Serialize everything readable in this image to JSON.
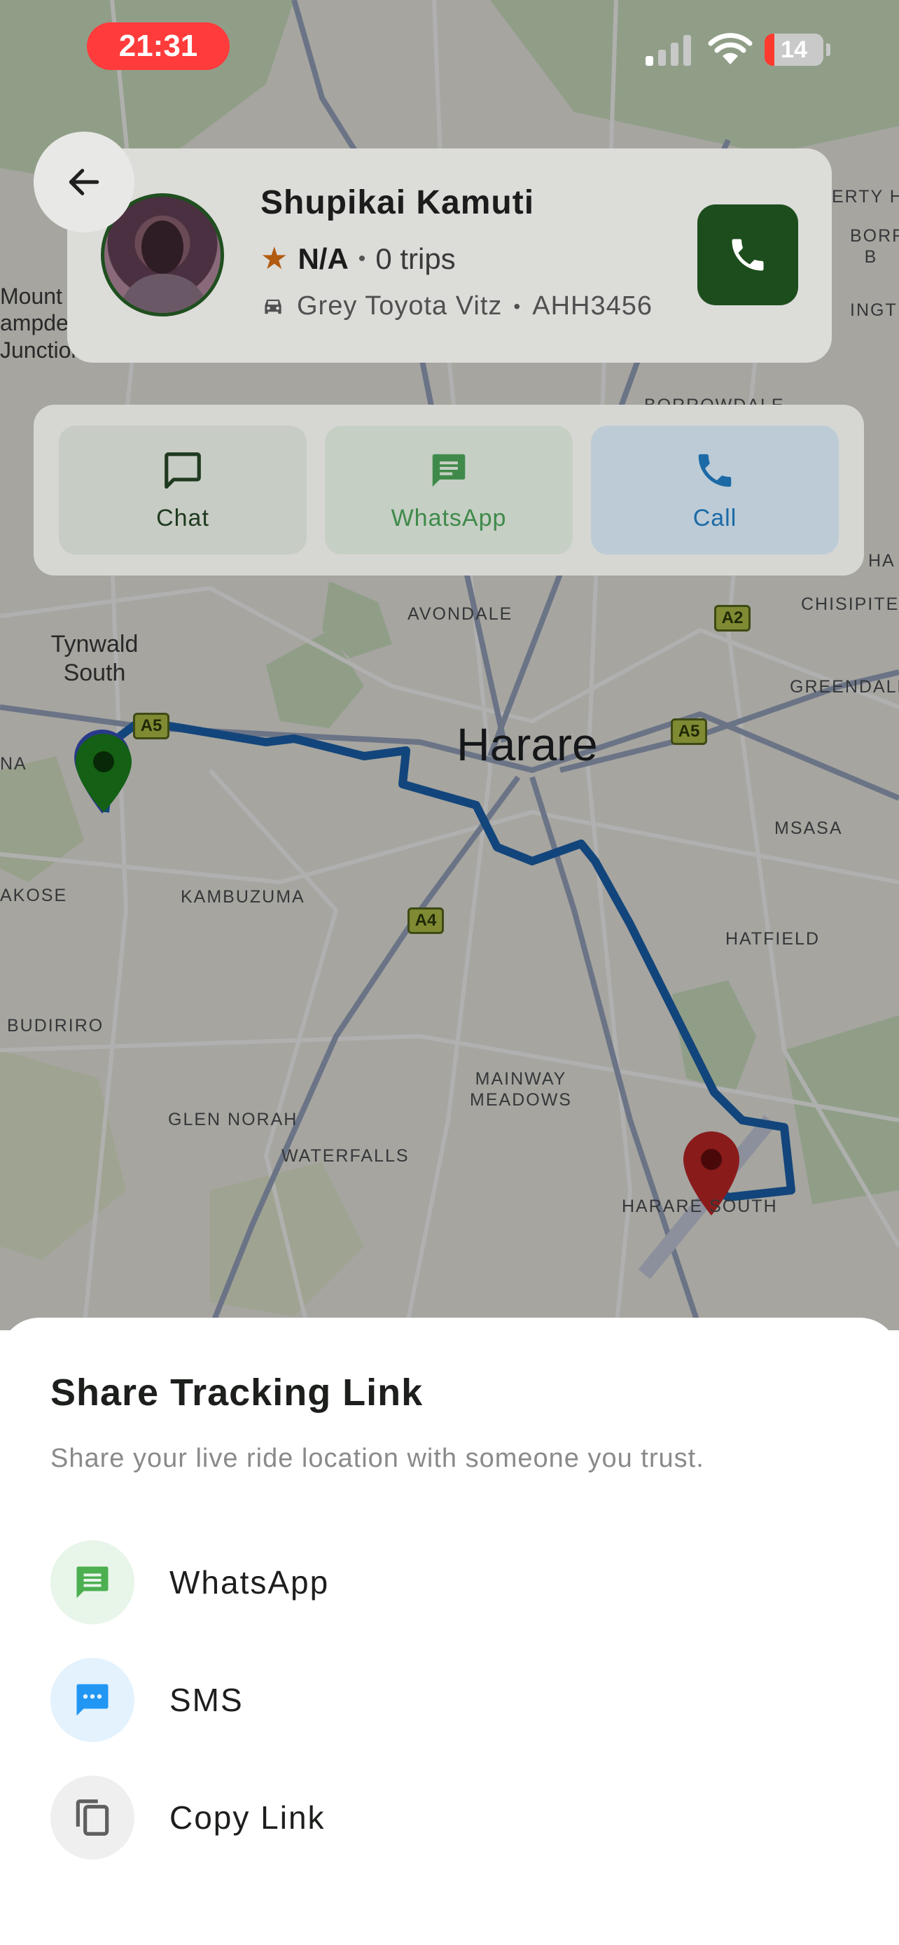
{
  "status_bar": {
    "time": "21:31",
    "battery": "14",
    "signal_icon": "cellular-signal-icon",
    "wifi_icon": "wifi-icon"
  },
  "driver": {
    "name": "Shupikai Kamuti",
    "rating": "N/A",
    "separator": "•",
    "trips": "0 trips",
    "vehicle": "Grey Toyota Vitz",
    "plate": "AHH3456",
    "star_icon": "star-icon",
    "car_icon": "car-icon",
    "call_icon": "phone-icon",
    "accent_color": "#1d4d1d"
  },
  "contact_actions": [
    {
      "label": "Chat",
      "icon": "chat-bubble-icon",
      "color": "#1f3a1f"
    },
    {
      "label": "WhatsApp",
      "icon": "message-icon",
      "color": "#3f8a4a"
    },
    {
      "label": "Call",
      "icon": "phone-icon",
      "color": "#1b6aa6"
    }
  ],
  "map": {
    "city": "Harare",
    "labels": [
      "AVONDALE",
      "Tynwald South",
      "KAMBUZUMA",
      "BUDIRIRO",
      "GLEN NORAH",
      "WATERFALLS",
      "MAINWAY MEADOWS",
      "HARARE SOUTH",
      "HATFIELD",
      "MSASA",
      "GREENDALE",
      "CHISIPITE",
      "BORROWDALE",
      "ERTY H",
      "BORR B",
      "INGT",
      "HA",
      "NA",
      "AKOSE",
      "Mount ampde Junction"
    ],
    "shields": [
      "A5",
      "A5",
      "A2",
      "A4"
    ],
    "route_color": "#1a63b0",
    "origin_pin_color": "#1e8a1e",
    "destination_pin_color": "#c62828"
  },
  "share_sheet": {
    "title": "Share Tracking Link",
    "subtitle": "Share your live ride location with someone you trust.",
    "options": [
      {
        "label": "WhatsApp",
        "icon": "whatsapp-message-icon",
        "color": "#4caf50"
      },
      {
        "label": "SMS",
        "icon": "sms-icon",
        "color": "#2196f3"
      },
      {
        "label": "Copy Link",
        "icon": "copy-icon",
        "color": "#5f5f5f"
      }
    ]
  }
}
